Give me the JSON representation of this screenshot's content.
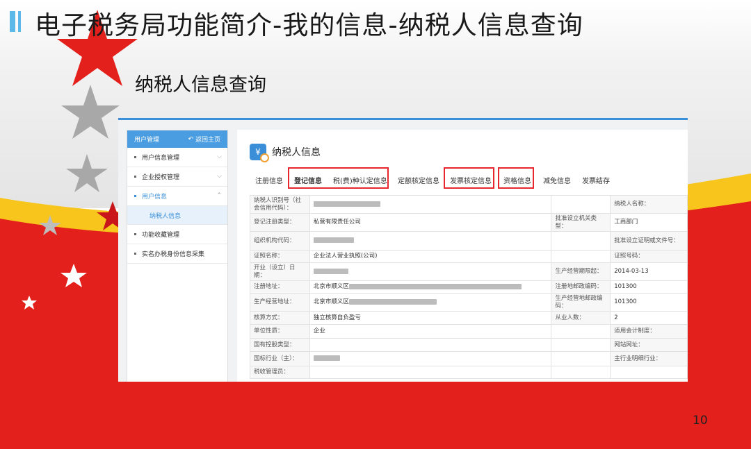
{
  "slide": {
    "title": "电子税务局功能简介-我的信息-纳税人信息查询",
    "subtitle": "纳税人信息查询",
    "page_number": "10"
  },
  "sidebar": {
    "header": "用户管理",
    "back_label": "返回主页",
    "items": [
      {
        "label": "用户信息管理"
      },
      {
        "label": "企业授权管理"
      },
      {
        "label": "用户信息"
      },
      {
        "label": "纳税人信息"
      },
      {
        "label": "功能收藏管理"
      },
      {
        "label": "实名办税身份信息采集"
      }
    ]
  },
  "panel": {
    "title": "纳税人信息",
    "icon_glyph": "¥"
  },
  "tabs": [
    "注册信息",
    "登记信息",
    "税(费)种认定信息",
    "定额核定信息",
    "发票核定信息",
    "资格信息",
    "减免信息",
    "发票结存"
  ],
  "table": {
    "r1": {
      "l1": "纳税人识别号（社会信用代码）：",
      "l2": "纳税人名称："
    },
    "r2": {
      "l1": "登记注册类型：",
      "v1": "私营有限责任公司",
      "l2": "批准设立机关类型：",
      "v2": "工商部门"
    },
    "r3": {
      "l1": "组织机构代码：",
      "l2": "批准设立证明或文件号："
    },
    "r4": {
      "l1": "证照名称：",
      "v1": "企业法人营业执照(公司)",
      "l2": "证照号码："
    },
    "r5": {
      "l1": "开业（设立）日期：",
      "l2": "生产经营期限起：",
      "v2": "2014-03-13"
    },
    "r6": {
      "l1": "注册地址：",
      "v1": "北京市顺义区",
      "l2": "注册地邮政编码：",
      "v2": "101300"
    },
    "r7": {
      "l1": "生产经营地址：",
      "v1": "北京市顺义区",
      "l2": "生产经营地邮政编码：",
      "v2": "101300"
    },
    "r8": {
      "l1": "核算方式：",
      "v1": "独立核算自负盈亏",
      "l2": "从业人数：",
      "v2": "2"
    },
    "r9": {
      "l1": "单位性质：",
      "v1": "企业",
      "l3": "适用会计制度："
    },
    "r10": {
      "l1": "国有控股类型：",
      "l3": "网站网址："
    },
    "r11": {
      "l1": "国标行业（主）：",
      "l3": "主行业明细行业："
    },
    "r12": {
      "l1": "税收管理员："
    }
  },
  "colors": {
    "accent": "#3a8fd8",
    "highlight": "#e8262d",
    "ribbon_red": "#e3201b",
    "ribbon_yellow": "#f7c51b"
  }
}
